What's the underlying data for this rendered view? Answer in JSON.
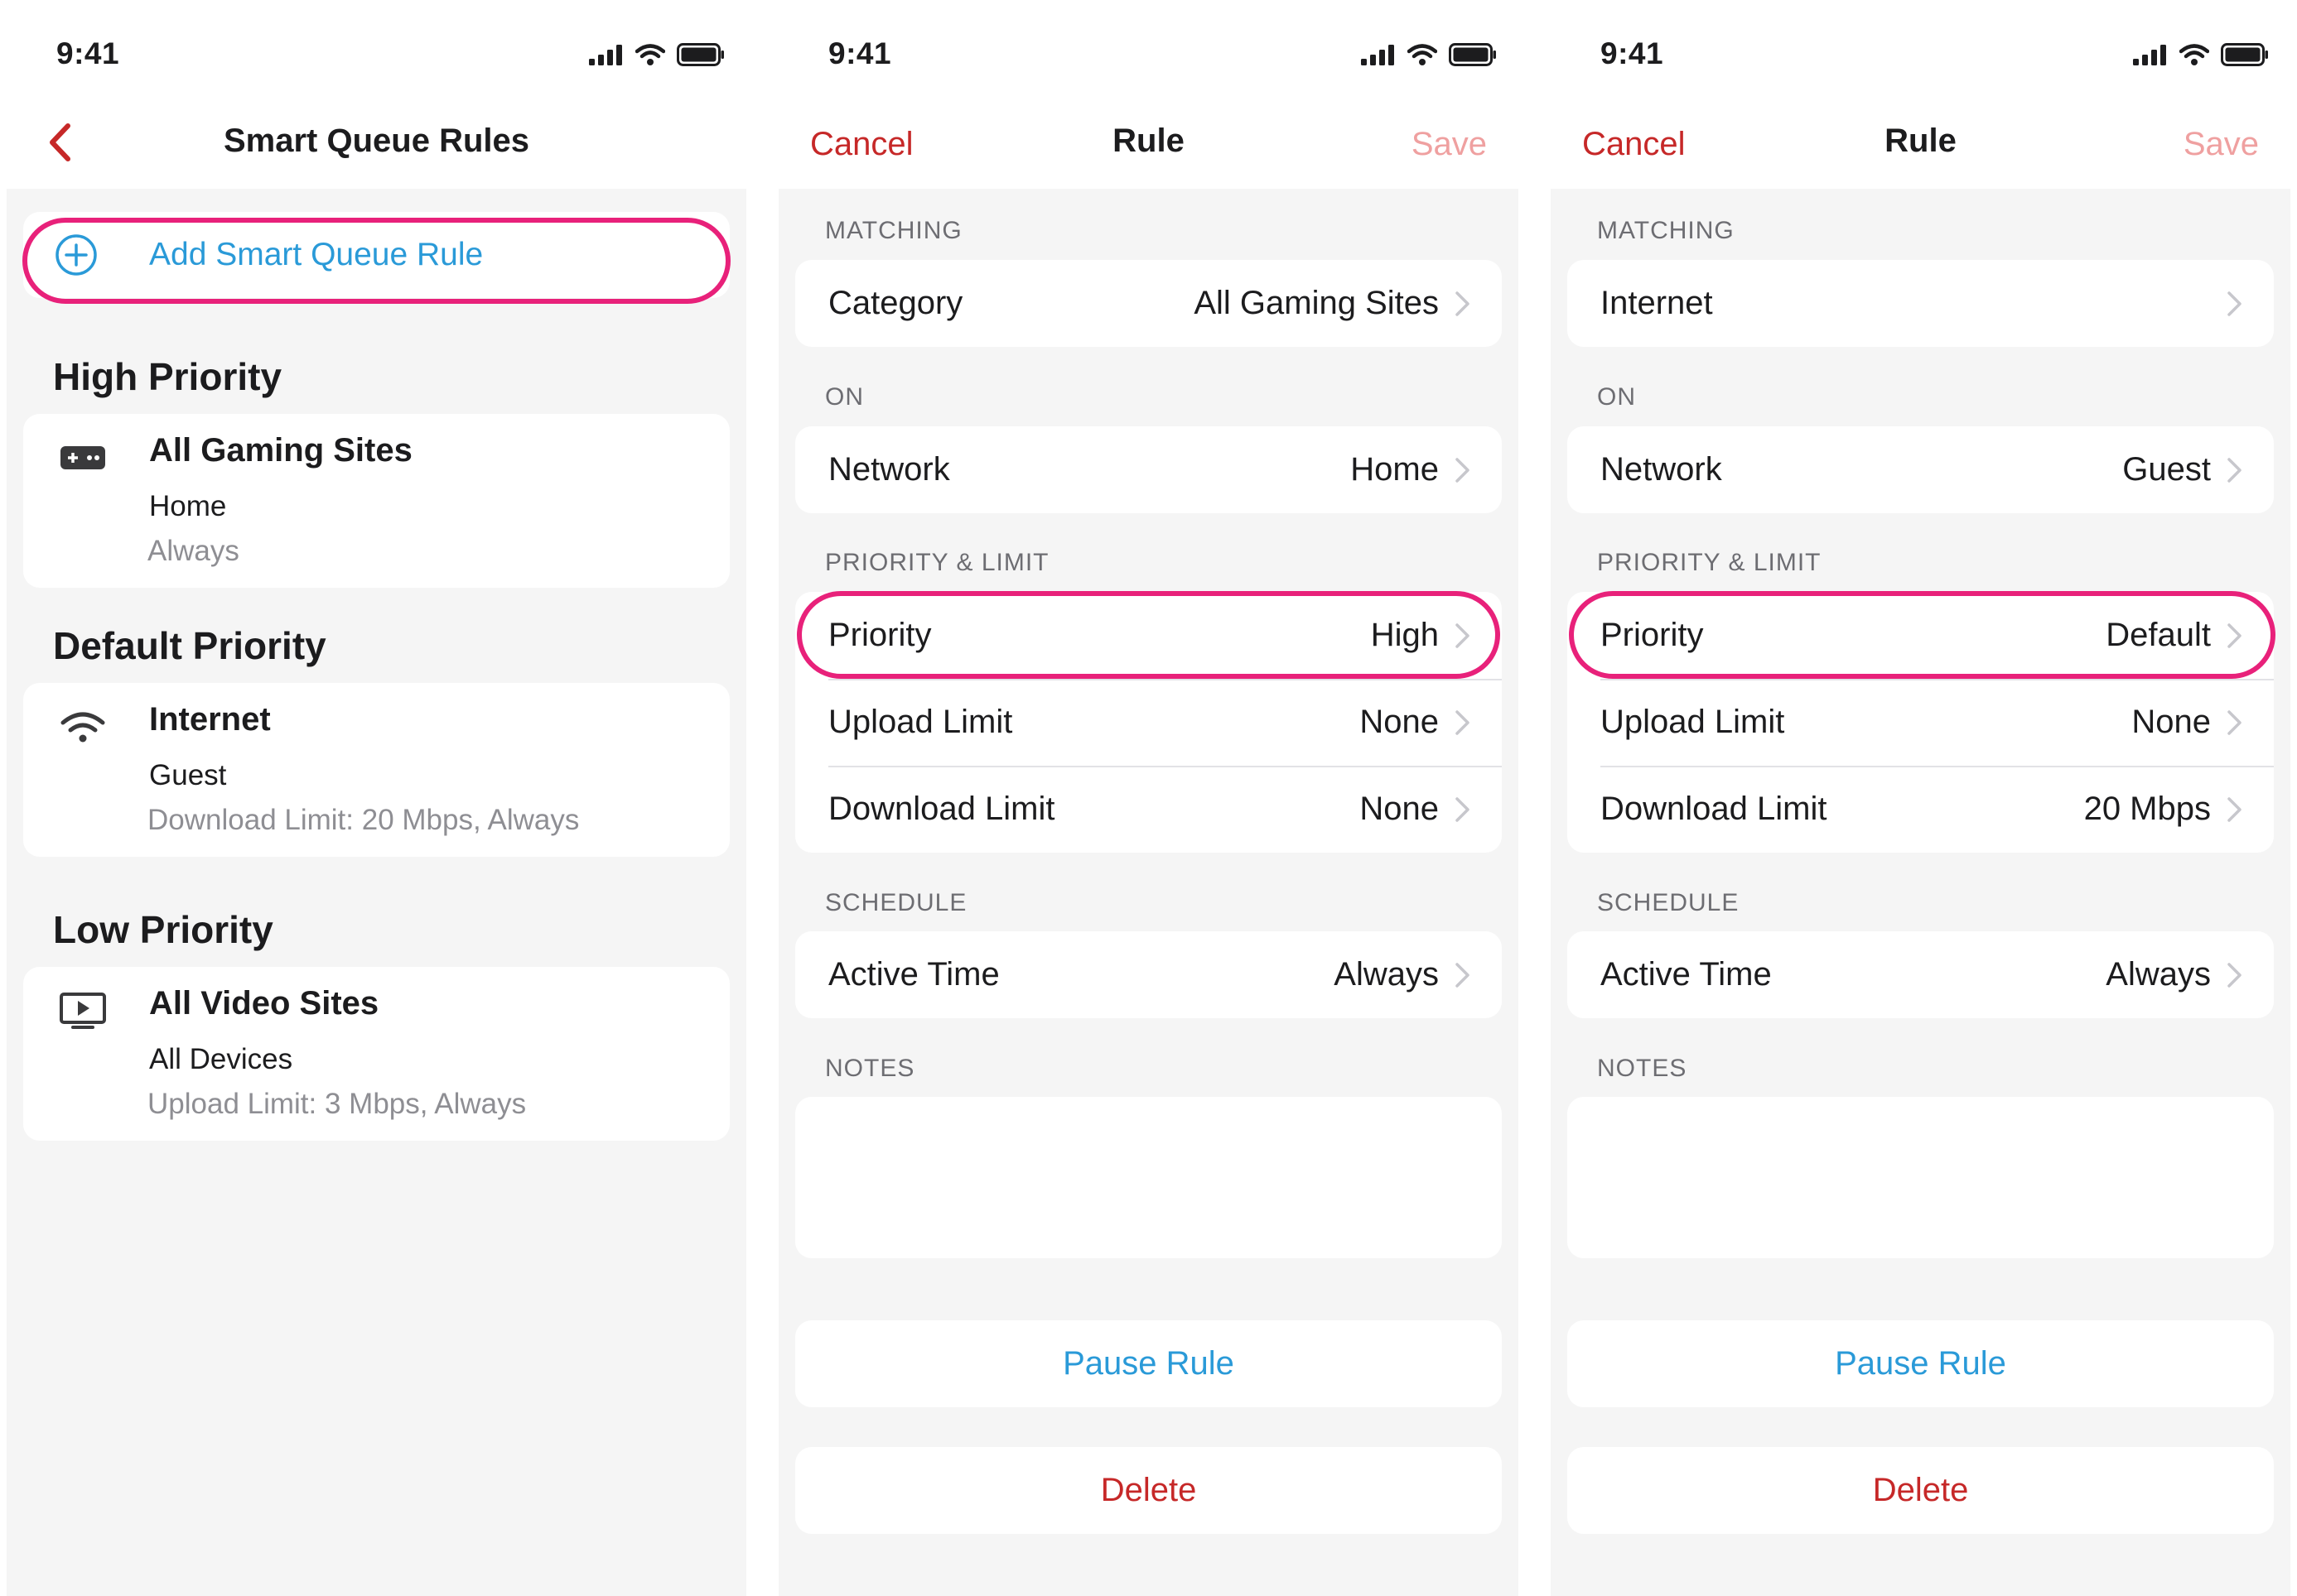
{
  "colors": {
    "accent_red": "#c62828",
    "link_blue": "#2a9ad8",
    "highlight_pink": "#e8217a",
    "save_disabled": "#efa0a0"
  },
  "screens": [
    {
      "status_time": "9:41",
      "nav": {
        "title": "Smart Queue Rules",
        "back_icon": "chevron-left-icon"
      },
      "add_rule_label": "Add Smart Queue Rule",
      "sections": [
        {
          "title": "High Priority",
          "rule": {
            "icon": "gamepad-icon",
            "name": "All Gaming Sites",
            "network": "Home",
            "detail": "Always"
          }
        },
        {
          "title": "Default Priority",
          "rule": {
            "icon": "wifi-icon",
            "name": "Internet",
            "network": "Guest",
            "detail": "Download Limit: 20 Mbps, Always"
          }
        },
        {
          "title": "Low Priority",
          "rule": {
            "icon": "video-play-icon",
            "name": "All Video Sites",
            "network": "All Devices",
            "detail": "Upload Limit: 3 Mbps, Always"
          }
        }
      ]
    },
    {
      "status_time": "9:41",
      "nav": {
        "cancel": "Cancel",
        "title": "Rule",
        "save": "Save"
      },
      "groups": {
        "matching": {
          "label": "MATCHING",
          "rows": [
            {
              "label": "Category",
              "value": "All Gaming Sites"
            }
          ]
        },
        "on": {
          "label": "ON",
          "rows": [
            {
              "label": "Network",
              "value": "Home"
            }
          ]
        },
        "priority_limit": {
          "label": "PRIORITY & LIMIT",
          "rows": [
            {
              "label": "Priority",
              "value": "High"
            },
            {
              "label": "Upload Limit",
              "value": "None"
            },
            {
              "label": "Download Limit",
              "value": "None"
            }
          ]
        },
        "schedule": {
          "label": "SCHEDULE",
          "rows": [
            {
              "label": "Active Time",
              "value": "Always"
            }
          ]
        },
        "notes": {
          "label": "NOTES",
          "value": ""
        }
      },
      "actions": {
        "pause": "Pause Rule",
        "delete": "Delete"
      }
    },
    {
      "status_time": "9:41",
      "nav": {
        "cancel": "Cancel",
        "title": "Rule",
        "save": "Save"
      },
      "groups": {
        "matching": {
          "label": "MATCHING",
          "rows": [
            {
              "label": "Internet",
              "value": ""
            }
          ]
        },
        "on": {
          "label": "ON",
          "rows": [
            {
              "label": "Network",
              "value": "Guest"
            }
          ]
        },
        "priority_limit": {
          "label": "PRIORITY & LIMIT",
          "rows": [
            {
              "label": "Priority",
              "value": "Default"
            },
            {
              "label": "Upload Limit",
              "value": "None"
            },
            {
              "label": "Download Limit",
              "value": "20 Mbps"
            }
          ]
        },
        "schedule": {
          "label": "SCHEDULE",
          "rows": [
            {
              "label": "Active Time",
              "value": "Always"
            }
          ]
        },
        "notes": {
          "label": "NOTES",
          "value": ""
        }
      },
      "actions": {
        "pause": "Pause Rule",
        "delete": "Delete"
      }
    }
  ]
}
